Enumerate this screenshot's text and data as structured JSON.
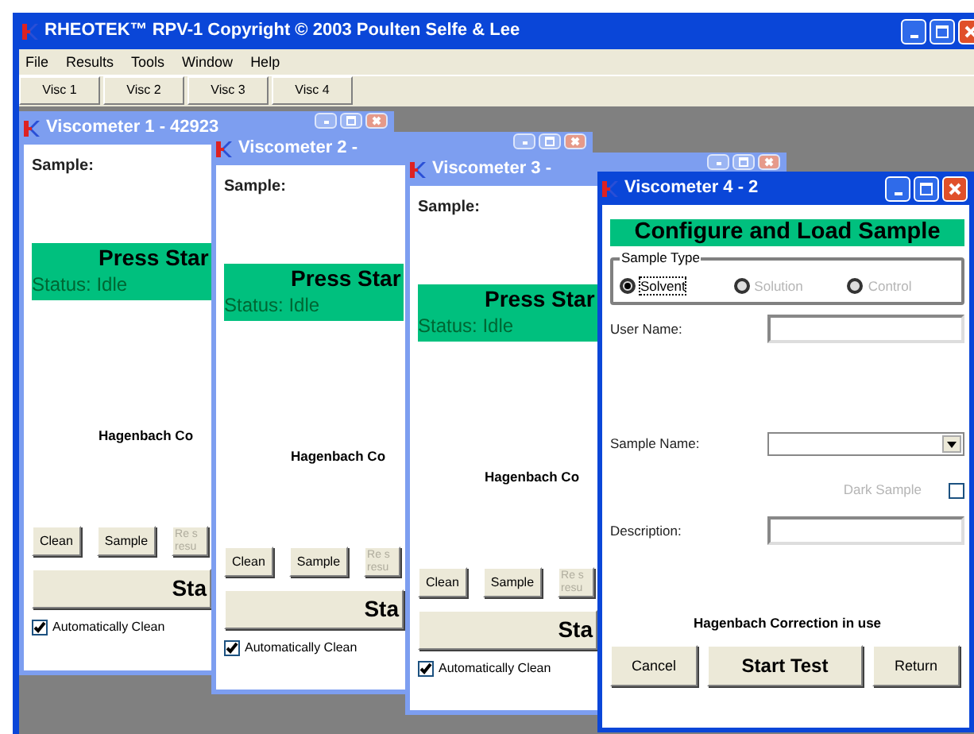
{
  "app": {
    "title": "RHEOTEK™ RPV-1  Copyright © 2003 Poulten Selfe & Lee"
  },
  "menu": [
    "File",
    "Results",
    "Tools",
    "Window",
    "Help"
  ],
  "toolbar_tabs": [
    "Visc 1",
    "Visc 2",
    "Visc 3",
    "Visc 4"
  ],
  "viscometers": [
    {
      "title": "Viscometer 1 - 42923",
      "active": false,
      "sample_label": "Sample:",
      "prompt": "Press Star",
      "status": "Status: Idle",
      "correction": "Hagenbach Co",
      "buttons": [
        {
          "label": "Clean",
          "disabled": false
        },
        {
          "label": "Sample",
          "disabled": false
        },
        {
          "label": "Re s\nresu",
          "disabled": true
        }
      ],
      "start_button": "Sta",
      "auto_clean": {
        "label": "Automatically Clean",
        "checked": true
      }
    },
    {
      "title": "Viscometer 2 -",
      "active": false,
      "sample_label": "Sample:",
      "prompt": "Press Star",
      "status": "Status: Idle",
      "correction": "Hagenbach Co",
      "buttons": [
        {
          "label": "Clean",
          "disabled": false
        },
        {
          "label": "Sample",
          "disabled": false
        },
        {
          "label": "Re s\nresu",
          "disabled": true
        }
      ],
      "start_button": "Sta",
      "auto_clean": {
        "label": "Automatically Clean",
        "checked": true
      }
    },
    {
      "title": "Viscometer 3 -",
      "active": false,
      "sample_label": "Sample:",
      "prompt": "Press Star",
      "status": "Status: Idle",
      "correction": "Hagenbach Co",
      "buttons": [
        {
          "label": "Clean",
          "disabled": false
        },
        {
          "label": "Sample",
          "disabled": false
        },
        {
          "label": "Re s\nresu",
          "disabled": true
        }
      ],
      "start_button": "Sta",
      "auto_clean": {
        "label": "Automatically Clean",
        "checked": true
      }
    }
  ],
  "configure_window": {
    "title": "Viscometer 4 - 2",
    "active": true,
    "heading": "Configure and Load Sample",
    "sample_type": {
      "legend": "Sample Type",
      "options": [
        {
          "label": "Solvent",
          "selected": true,
          "disabled": false
        },
        {
          "label": "Solution",
          "selected": false,
          "disabled": true
        },
        {
          "label": "Control",
          "selected": false,
          "disabled": true
        }
      ]
    },
    "user_name": {
      "label": "User Name:"
    },
    "sample_name": {
      "label": "Sample Name:"
    },
    "dark_sample": {
      "label": "Dark Sample",
      "checked": false,
      "disabled": true
    },
    "description": {
      "label": "Description:"
    },
    "correction": "Hagenbach Correction in use",
    "buttons": [
      {
        "label": "Cancel",
        "kind": "normal"
      },
      {
        "label": "Start Test",
        "kind": "primary"
      },
      {
        "label": "Return",
        "kind": "normal"
      }
    ]
  }
}
